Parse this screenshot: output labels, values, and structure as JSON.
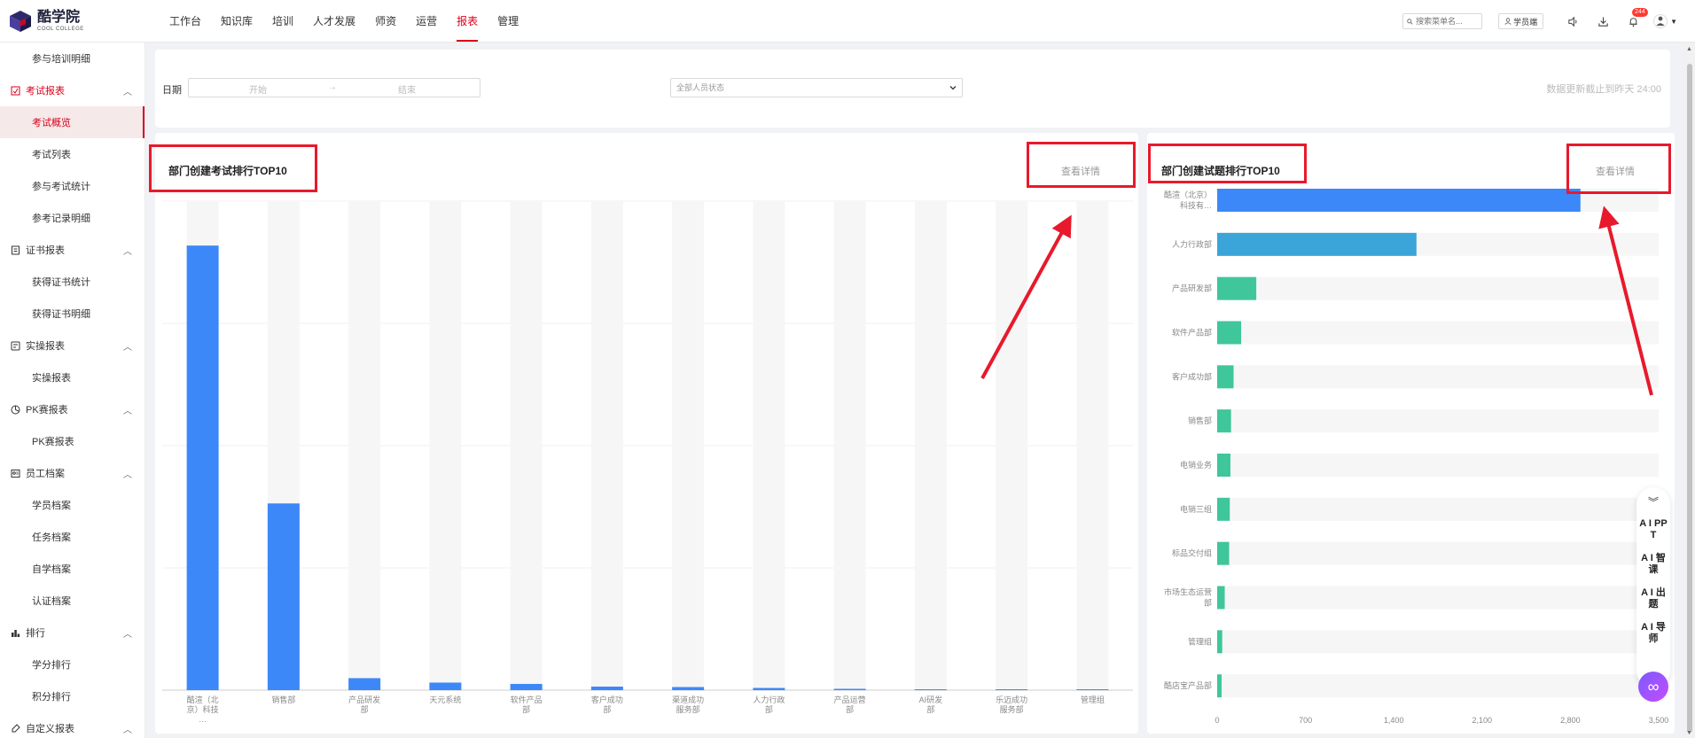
{
  "app": {
    "logo_cn": "酷学院",
    "logo_en": "COOL COLLEGE",
    "nav": [
      "工作台",
      "知识库",
      "培训",
      "人才发展",
      "师资",
      "运营",
      "报表",
      "管理"
    ],
    "nav_active": 6,
    "search_placeholder": "搜索菜单名...",
    "student_btn": "学员端",
    "notif_badge": "244"
  },
  "sidebar": {
    "items": [
      {
        "type": "sub",
        "label": "参与培训明细"
      },
      {
        "type": "group",
        "label": "考试报表",
        "icon": "exam-report-icon",
        "red": true
      },
      {
        "type": "sub",
        "label": "考试概览",
        "active": true
      },
      {
        "type": "sub",
        "label": "考试列表"
      },
      {
        "type": "sub",
        "label": "参与考试统计"
      },
      {
        "type": "sub",
        "label": "参考记录明细"
      },
      {
        "type": "group",
        "label": "证书报表",
        "icon": "certificate-icon"
      },
      {
        "type": "sub",
        "label": "获得证书统计"
      },
      {
        "type": "sub",
        "label": "获得证书明细"
      },
      {
        "type": "group",
        "label": "实操报表",
        "icon": "practice-icon"
      },
      {
        "type": "sub",
        "label": "实操报表"
      },
      {
        "type": "group",
        "label": "PK赛报表",
        "icon": "pk-icon"
      },
      {
        "type": "sub",
        "label": "PK赛报表"
      },
      {
        "type": "group",
        "label": "员工档案",
        "icon": "employee-file-icon"
      },
      {
        "type": "sub",
        "label": "学员档案"
      },
      {
        "type": "sub",
        "label": "任务档案"
      },
      {
        "type": "sub",
        "label": "自学档案"
      },
      {
        "type": "sub",
        "label": "认证档案"
      },
      {
        "type": "group",
        "label": "排行",
        "icon": "ranking-icon"
      },
      {
        "type": "sub",
        "label": "学分排行"
      },
      {
        "type": "sub",
        "label": "积分排行"
      },
      {
        "type": "group",
        "label": "自定义报表",
        "icon": "custom-report-icon"
      }
    ]
  },
  "filter": {
    "date_label": "日期",
    "start_placeholder": "开始",
    "range_sep": "→",
    "end_placeholder": "结束",
    "status_placeholder": "全部人员状态",
    "update_note": "数据更新截止到昨天 24:00"
  },
  "left_card": {
    "title": "部门创建考试排行TOP10",
    "detail_link": "查看详情"
  },
  "right_card": {
    "title": "部门创建试题排行TOP10",
    "detail_link": "查看详情"
  },
  "ai_panel": {
    "buttons": [
      "A I PPT",
      "A I 智课",
      "A I 出题",
      "A I 导师"
    ]
  },
  "colors": {
    "accent_red": "#d9001b",
    "bar_blue": "#3d88f8",
    "bar_teal_blue": "#3ba4d8",
    "bar_green": "#3fc69a",
    "annotation_red": "#e8192c"
  },
  "chart_data": [
    {
      "type": "bar",
      "title": "部门创建考试排行TOP10",
      "categories": [
        "酷渲（北京）科技…",
        "销售部",
        "产品研发部",
        "天元系统",
        "软件产品部",
        "客户成功部",
        "渠道成功服务部",
        "人力行政部",
        "产品运营部",
        "AI研发部",
        "乐迈成功服务部",
        "管理组"
      ],
      "category_lines": [
        [
          "酷渲（北",
          "京）科技",
          "…"
        ],
        [
          "销售部"
        ],
        [
          "产品研发",
          "部"
        ],
        [
          "天元系统"
        ],
        [
          "软件产品",
          "部"
        ],
        [
          "客户成功",
          "部"
        ],
        [
          "渠道成功",
          "服务部"
        ],
        [
          "人力行政",
          "部"
        ],
        [
          "产品运营",
          "部"
        ],
        [
          "AI研发",
          "部"
        ],
        [
          "乐迈成功",
          "服务部"
        ],
        [
          "管理组"
        ]
      ],
      "values": [
        100,
        42,
        2.7,
        1.7,
        1.4,
        0.8,
        0.7,
        0.5,
        0.3,
        0.2,
        0.2,
        0.2
      ],
      "ylim": [
        0,
        110
      ],
      "grid": true,
      "color": "#3d88f8"
    },
    {
      "type": "bar",
      "orientation": "horizontal",
      "title": "部门创建试题排行TOP10",
      "categories": [
        "酷渲（北京）科技有…",
        "人力行政部",
        "产品研发部",
        "软件产品部",
        "客户成功部",
        "销售部",
        "电销业务",
        "电销三组",
        "标品交付组",
        "市场生态运营部",
        "管理组",
        "酷店宝产品部"
      ],
      "category_lines": [
        [
          "酷渲（北京）",
          "科技有…"
        ],
        [
          "人力行政部"
        ],
        [
          "产品研发部"
        ],
        [
          "软件产品部"
        ],
        [
          "客户成功部"
        ],
        [
          "销售部"
        ],
        [
          "电销业务"
        ],
        [
          "电销三组"
        ],
        [
          "标品交付组"
        ],
        [
          "市场生态运营",
          "部"
        ],
        [
          "管理组"
        ],
        [
          "酷店宝产品部"
        ]
      ],
      "values": [
        2880,
        1580,
        310,
        190,
        130,
        110,
        105,
        100,
        95,
        60,
        40,
        35
      ],
      "xlim": [
        0,
        3500
      ],
      "xticks": [
        "0",
        "700",
        "1,400",
        "2,100",
        "2,800",
        "3,500"
      ],
      "colors": [
        "#3d88f8",
        "#3ba4d8",
        "#3fc69a",
        "#3fc69a",
        "#3fc69a",
        "#3fc69a",
        "#3fc69a",
        "#3fc69a",
        "#3fc69a",
        "#3fc69a",
        "#3fc69a",
        "#3fc69a"
      ]
    }
  ]
}
